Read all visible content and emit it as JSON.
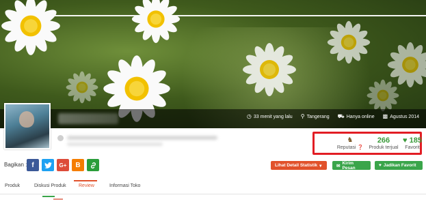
{
  "cover": {
    "meta": [
      {
        "icon": "clock-icon",
        "text": "33 menit yang lalu"
      },
      {
        "icon": "location-pin-icon",
        "text": "Tangerang"
      },
      {
        "icon": "truck-icon",
        "text": "Hanya online"
      },
      {
        "icon": "calendar-icon",
        "text": "Agustus 2014"
      }
    ]
  },
  "stats": {
    "reputasi_label": "Reputasi",
    "produk_value": "266",
    "produk_label": "Produk terjual",
    "favorit_value": "185",
    "favorit_label": "Favorit"
  },
  "share": {
    "label": "Bagikan :",
    "buttons": [
      "f",
      "t",
      "G+",
      "B",
      "link"
    ]
  },
  "actions": {
    "statistik": "Lihat Detail Statistik",
    "pesan": "Kirim Pesan",
    "favorit": "Jadikan Favorit"
  },
  "tabs": [
    {
      "label": "Produk"
    },
    {
      "label": "Diskusi Produk"
    },
    {
      "label": "Review",
      "active": true
    },
    {
      "label": "Informasi Toko"
    }
  ],
  "colors": {
    "accent": "#e1512a",
    "green": "#3aa54a",
    "highlight": "#e21d24"
  }
}
